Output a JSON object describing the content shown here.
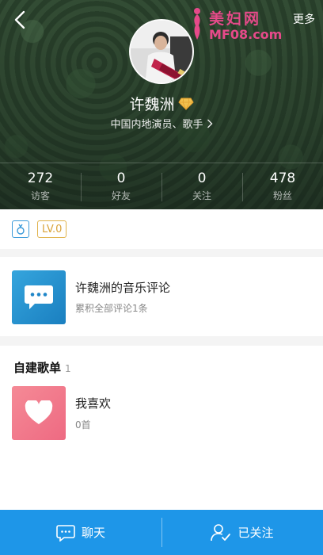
{
  "header": {
    "back_icon": "back-arrow-icon",
    "more_label": "更多",
    "watermark": {
      "line1": "美妇网",
      "line2": "MF08.com"
    },
    "avatar_icon": "avatar-image"
  },
  "profile": {
    "name": "许魏洲",
    "verified_icon": "diamond-badge-icon",
    "description": "中国内地演员、歌手",
    "chevron": ">"
  },
  "stats": [
    {
      "value": "272",
      "label": "访客"
    },
    {
      "value": "0",
      "label": "好友"
    },
    {
      "value": "0",
      "label": "关注"
    },
    {
      "value": "478",
      "label": "粉丝"
    }
  ],
  "badges": {
    "level_icon": "music-level-icon",
    "lv_label": "LV.0"
  },
  "comments": {
    "title": "许魏洲的音乐评论",
    "subtitle": "累积全部评论1条",
    "icon": "chat-bubble-icon"
  },
  "playlists": {
    "section_title": "自建歌单",
    "section_count": "1",
    "items": [
      {
        "title": "我喜欢",
        "subtitle": "0首",
        "icon": "heart-icon"
      }
    ]
  },
  "bottom_bar": {
    "chat_label": "聊天",
    "follow_label": "已关注"
  },
  "colors": {
    "accent": "#1e96e8",
    "comment_thumb": "#2a93d1",
    "playlist_thumb": "#f27a8c",
    "level_badge": "#e0b24a"
  }
}
